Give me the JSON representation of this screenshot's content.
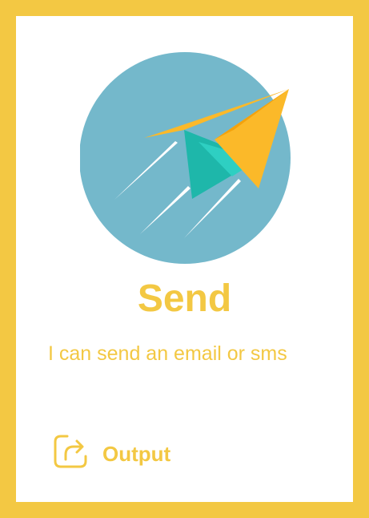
{
  "card": {
    "title": "Send",
    "description": "I can send an email or sms",
    "output_label": "Output",
    "icon": "paper-plane-icon",
    "output_icon": "share-arrow-icon"
  },
  "colors": {
    "accent": "#F3C843",
    "circle": "#74B8CB",
    "plane_yellow": "#FBB929",
    "plane_orange": "#F4A20C",
    "plane_teal": "#2ECFC2",
    "plane_teal_dark": "#1EB7AA"
  }
}
